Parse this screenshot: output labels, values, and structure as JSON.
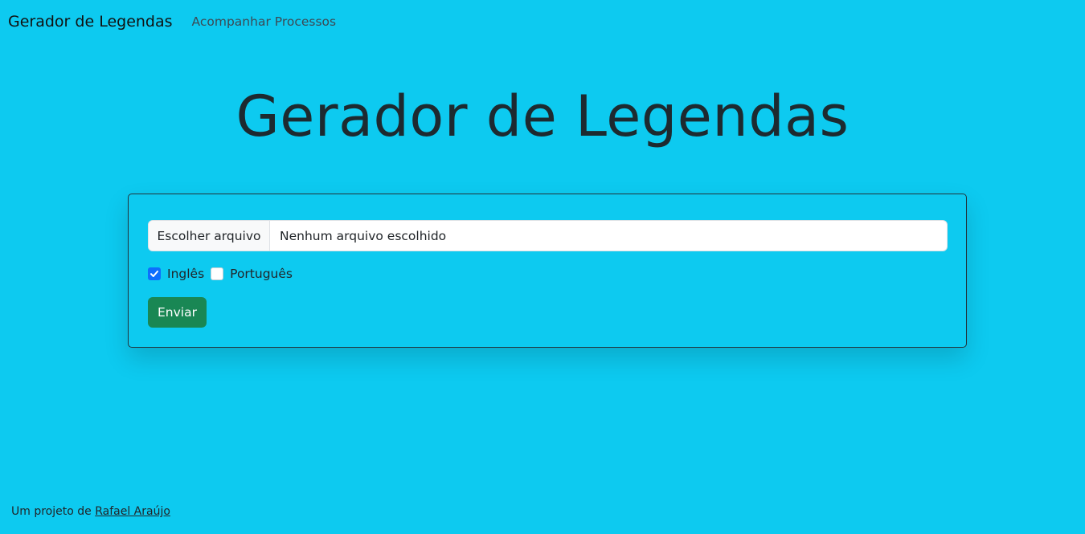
{
  "navbar": {
    "brand": "Gerador de Legendas",
    "link": "Acompanhar Processos"
  },
  "hero": {
    "title": "Gerador de Legendas"
  },
  "form": {
    "file_button_label": "Escolher arquivo",
    "file_status": "Nenhum arquivo escolhido",
    "languages": [
      {
        "label": "Inglês",
        "checked": true
      },
      {
        "label": "Português",
        "checked": false
      }
    ],
    "submit_label": "Enviar"
  },
  "footer": {
    "prefix": "Um projeto de",
    "author": "Rafael Araújo"
  },
  "colors": {
    "background": "#0dcaf0",
    "submit": "#198754",
    "checkbox_checked": "#0d6efd"
  }
}
